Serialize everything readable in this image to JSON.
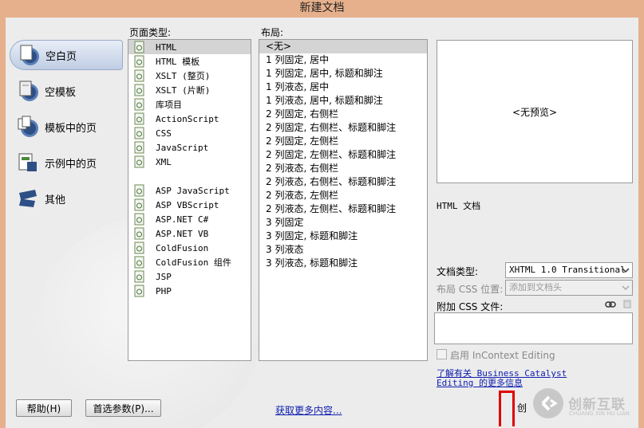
{
  "window": {
    "title": "新建文档"
  },
  "categories": [
    {
      "label": "空白页",
      "icon": "blank-page-icon",
      "selected": true
    },
    {
      "label": "空模板",
      "icon": "blank-template-icon",
      "selected": false
    },
    {
      "label": "模板中的页",
      "icon": "template-page-icon",
      "selected": false
    },
    {
      "label": "示例中的页",
      "icon": "sample-page-icon",
      "selected": false
    },
    {
      "label": "其他",
      "icon": "other-icon",
      "selected": false
    }
  ],
  "page_type": {
    "label": "页面类型:",
    "items": [
      "HTML",
      "HTML 模板",
      "XSLT (整页)",
      "XSLT (片断)",
      "库项目",
      "ActionScript",
      "CSS",
      "JavaScript",
      "XML",
      "",
      "ASP JavaScript",
      "ASP VBScript",
      "ASP.NET C#",
      "ASP.NET VB",
      "ColdFusion",
      "ColdFusion 组件",
      "JSP",
      "PHP"
    ],
    "selected_index": 0
  },
  "layout": {
    "label": "布局:",
    "items": [
      "<无>",
      "1 列固定, 居中",
      "1 列固定, 居中, 标题和脚注",
      "1 列液态, 居中",
      "1 列液态, 居中, 标题和脚注",
      "2 列固定, 右侧栏",
      "2 列固定, 右侧栏、标题和脚注",
      "2 列固定, 左侧栏",
      "2 列固定, 左侧栏、标题和脚注",
      "2 列液态, 右侧栏",
      "2 列液态, 右侧栏、标题和脚注",
      "2 列液态, 左侧栏",
      "2 列液态, 左侧栏、标题和脚注",
      "3 列固定",
      "3 列固定, 标题和脚注",
      "3 列液态",
      "3 列液态, 标题和脚注"
    ],
    "selected_index": 0
  },
  "preview": {
    "text": "<无预览>"
  },
  "description": "HTML 文档",
  "doctype": {
    "label": "文档类型:",
    "value": "XHTML 1.0 Transitional"
  },
  "layout_css": {
    "label": "布局 CSS 位置:",
    "value": "添加到文档头"
  },
  "attach_css": {
    "label": "附加 CSS 文件:"
  },
  "incontext": {
    "label": "启用 InContext Editing"
  },
  "info_link": {
    "line1": "了解有关 Business Catalyst",
    "line2": "Editing 的更多信息"
  },
  "buttons": {
    "help": "帮助(H)",
    "prefs": "首选参数(P)...",
    "create_partial": "创"
  },
  "more_content_link": "获取更多内容...",
  "watermark": {
    "brand": "创新互联",
    "sub": "CHUANG XIN HU LIAN"
  }
}
